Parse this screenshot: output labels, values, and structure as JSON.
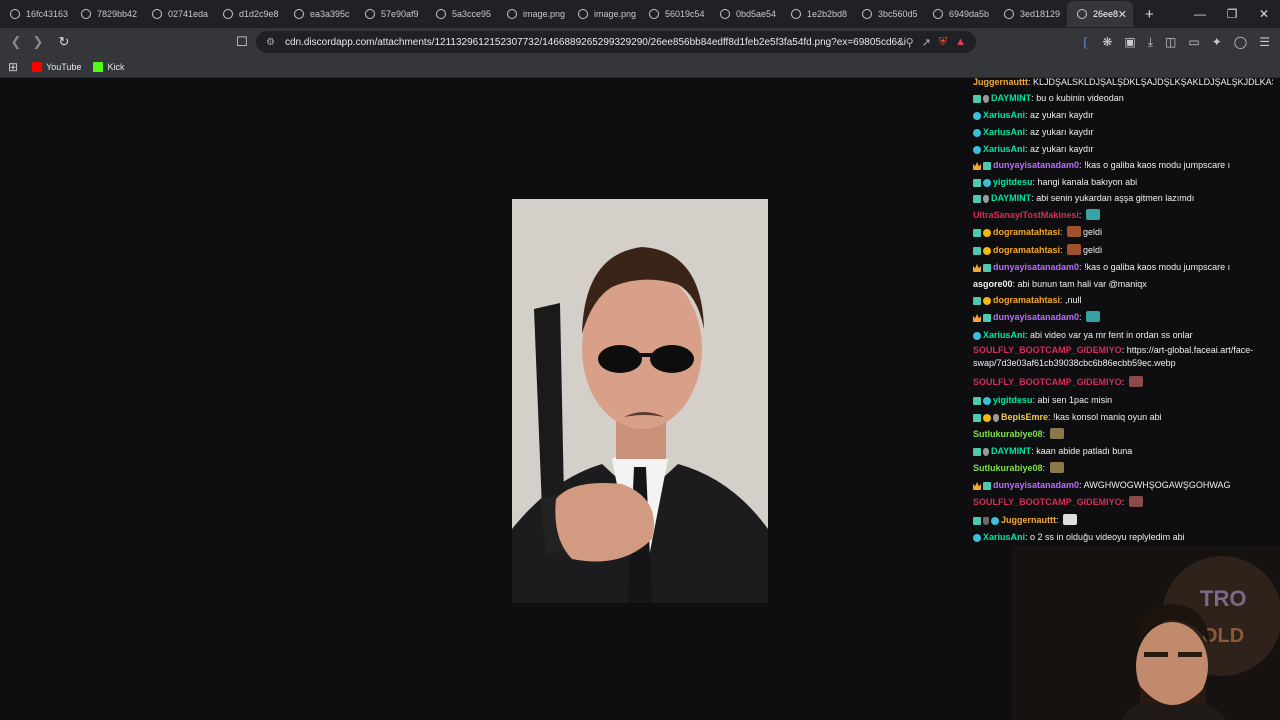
{
  "tabs": [
    {
      "label": "16fc43163"
    },
    {
      "label": "7829bb42"
    },
    {
      "label": "02741eda"
    },
    {
      "label": "d1d2c9e8"
    },
    {
      "label": "ea3a395c"
    },
    {
      "label": "57e90af9"
    },
    {
      "label": "5a3cce95"
    },
    {
      "label": "image.png"
    },
    {
      "label": "image.png"
    },
    {
      "label": "56019c54"
    },
    {
      "label": "0bd5ae54"
    },
    {
      "label": "1e2b2bd8"
    },
    {
      "label": "3bc560d5"
    },
    {
      "label": "6949da5b"
    },
    {
      "label": "3ed18129"
    },
    {
      "label": "26ee8"
    }
  ],
  "address": {
    "url": "cdn.discordapp.com/attachments/1211329612152307732/1466889265299329290/26ee856bb84edff8d1feb2e5f3fa54fd.png?ex=69805cd6&is=..."
  },
  "bookmarks": [
    {
      "label": "YouTube",
      "icon": "youtube-icon"
    },
    {
      "label": "Kick",
      "icon": "kick-icon"
    }
  ],
  "chat": {
    "messages": [
      {
        "user": "Juggernauttt",
        "color": "#f3a93c",
        "badges": [],
        "text": "KLJDŞALSKLDJŞALŞDKLŞAJDŞLKŞAKLDJŞALŞKJDLKAŞŞJDŞ"
      },
      {
        "user": "DAYMINT",
        "color": "#00e5a0",
        "badges": [
          "grid",
          "mic"
        ],
        "text": "bu o kubinin videodan"
      },
      {
        "user": "XariusAni",
        "color": "#00e5a0",
        "badges": [
          "blue"
        ],
        "text": "az yukarı kaydır"
      },
      {
        "user": "XariusAni",
        "color": "#00e5a0",
        "badges": [
          "blue"
        ],
        "text": "az yukarı kaydır"
      },
      {
        "user": "XariusAni",
        "color": "#00e5a0",
        "badges": [
          "blue"
        ],
        "text": "az yukarı kaydır"
      },
      {
        "user": "dunyayisatanadam0",
        "color": "#b86bff",
        "badges": [
          "crown",
          "grid"
        ],
        "text": "!kas o galiba kaos modu jumpscare ı"
      },
      {
        "user": "yigitdesu",
        "color": "#00e5a0",
        "badges": [
          "grid",
          "blue"
        ],
        "text": "hangi kanala bakıyon abi"
      },
      {
        "user": "DAYMINT",
        "color": "#00e5a0",
        "badges": [
          "grid",
          "mic"
        ],
        "text": "abi senin yukardan aşşa gitmen lazımdı"
      },
      {
        "user": "UltraSanayiTostMakinesi",
        "color": "#d62b57",
        "badges": [],
        "text": ""
      },
      {
        "user": "dogramatahtasi",
        "color": "#f5a623",
        "badges": [
          "grid",
          "gold"
        ],
        "text": "geldi"
      },
      {
        "user": "dogramatahtasi",
        "color": "#f5a623",
        "badges": [
          "grid",
          "gold"
        ],
        "text": "geldi"
      },
      {
        "user": "dunyayisatanadam0",
        "color": "#b86bff",
        "badges": [
          "crown",
          "grid"
        ],
        "text": "!kas o galiba kaos modu jumpscare ı"
      },
      {
        "user": "asgore00",
        "color": "#efeff1",
        "badges": [],
        "text": "abi bunun tam hali var @maniqx"
      },
      {
        "user": "dogramatahtasi",
        "color": "#f5a623",
        "badges": [
          "grid",
          "gold"
        ],
        "text": ",null"
      },
      {
        "user": "dunyayisatanadam0",
        "color": "#b86bff",
        "badges": [
          "crown",
          "grid"
        ],
        "text": ""
      },
      {
        "user": "XariusAni",
        "color": "#00e5a0",
        "badges": [
          "blue"
        ],
        "text": "abi video var ya mr fent in ordan ss onlar"
      },
      {
        "user": "SOULFLY_BOOTCAMP_GIDEMIYO",
        "color": "#d62b57",
        "badges": [],
        "text": "https://art-global.faceai.art/face-swap/7d3e03af61cb39038cbc6b86ecbb59ec.webp"
      },
      {
        "user": "SOULFLY_BOOTCAMP_GIDEMIYO",
        "color": "#d62b57",
        "badges": [],
        "text": ""
      },
      {
        "user": "yigitdesu",
        "color": "#00e5a0",
        "badges": [
          "grid",
          "blue"
        ],
        "text": "abi sen 1pac misin"
      },
      {
        "user": "BepisEmre",
        "color": "#f2c94c",
        "badges": [
          "grid",
          "gold",
          "mic"
        ],
        "text": "!kas konsol maniq oyun abi"
      },
      {
        "user": "Sutlukurabiye08",
        "color": "#7ee04a",
        "badges": [],
        "text": ""
      },
      {
        "user": "DAYMINT",
        "color": "#00e5a0",
        "badges": [
          "grid",
          "mic"
        ],
        "text": "kaan abide patladı buna"
      },
      {
        "user": "Sutlukurabiye08",
        "color": "#7ee04a",
        "badges": [],
        "text": ""
      },
      {
        "user": "dunyayisatanadam0",
        "color": "#b86bff",
        "badges": [
          "crown",
          "grid"
        ],
        "text": "AWGHWOGWHŞOGAWŞGOHWAG"
      },
      {
        "user": "SOULFLY_BOOTCAMP_GIDEMIYO",
        "color": "#d62b57",
        "badges": [],
        "text": ""
      },
      {
        "user": "Juggernauttt",
        "color": "#f3a93c",
        "badges": [
          "grid",
          "shield",
          "blue"
        ],
        "text": ""
      },
      {
        "user": "XariusAni",
        "color": "#00e5a0",
        "badges": [
          "blue"
        ],
        "text": "o 2 ss in olduğu videoyu replyledim abi"
      }
    ]
  },
  "webcam": {
    "sign_text_1": "TRO",
    "sign_text_2": "OLD"
  }
}
